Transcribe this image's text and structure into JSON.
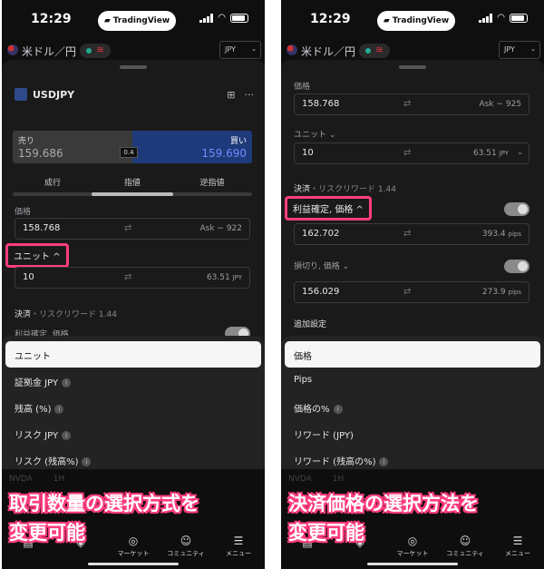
{
  "common": {
    "time": "12:29",
    "brand": "TradingView",
    "symbol": "米ドル／円",
    "currency_select": "JPY",
    "swap_glyph": "⇄",
    "chevron_up": "^",
    "chevron_down": "⌄",
    "info_glyph": "i"
  },
  "left": {
    "header": {
      "ticker": "USDJPY"
    },
    "sell": {
      "label": "売り",
      "price": "159.686"
    },
    "buy": {
      "label": "買い",
      "price": "159.690"
    },
    "spread": "0.4",
    "tabs": [
      "成行",
      "指値",
      "逆指値"
    ],
    "price_label": "価格",
    "price_field": {
      "value": "158.768",
      "right": "Ask − 922"
    },
    "unit_button": "ユニット",
    "unit_field": {
      "value": "10",
      "right": "63.51",
      "right_unit": "JPY"
    },
    "settlement": {
      "label": "決済",
      "extra": "・リスクリワード 1.44"
    },
    "tp_label": "利益確定, 価格",
    "options": [
      "ユニット",
      "証拠金 JPY",
      "残高 (%)",
      "リスク JPY",
      "リスク (残高%)"
    ],
    "ghost": [
      "NVDA",
      "1H"
    ],
    "caption": [
      "取引数量の選択方式を",
      "変更可能"
    ]
  },
  "right": {
    "price_label": "価格",
    "price_field": {
      "value": "158.768",
      "right": "Ask − 925"
    },
    "unit_label": "ユニット",
    "unit_field": {
      "value": "10",
      "right": "63.51",
      "right_unit": "JPY"
    },
    "settlement": {
      "label": "決済",
      "extra": "・リスクリワード 1.44"
    },
    "tp_button": "利益確定, 価格",
    "tp_field": {
      "value": "162.702",
      "right": "393.4",
      "right_unit": "pips"
    },
    "sl_label": "損切り, 価格",
    "sl_field": {
      "value": "156.029",
      "right": "273.9",
      "right_unit": "pips"
    },
    "advanced": "追加設定",
    "options": [
      "価格",
      "Pips",
      "価格の%",
      "リワード (JPY)",
      "リワード (残高の%)"
    ],
    "ghost": [
      "NVDA",
      "1H"
    ],
    "caption": [
      "決済価格の選択方法を",
      "変更可能"
    ]
  },
  "nav": [
    "マーケット",
    "コミュニティ",
    "メニュー"
  ]
}
